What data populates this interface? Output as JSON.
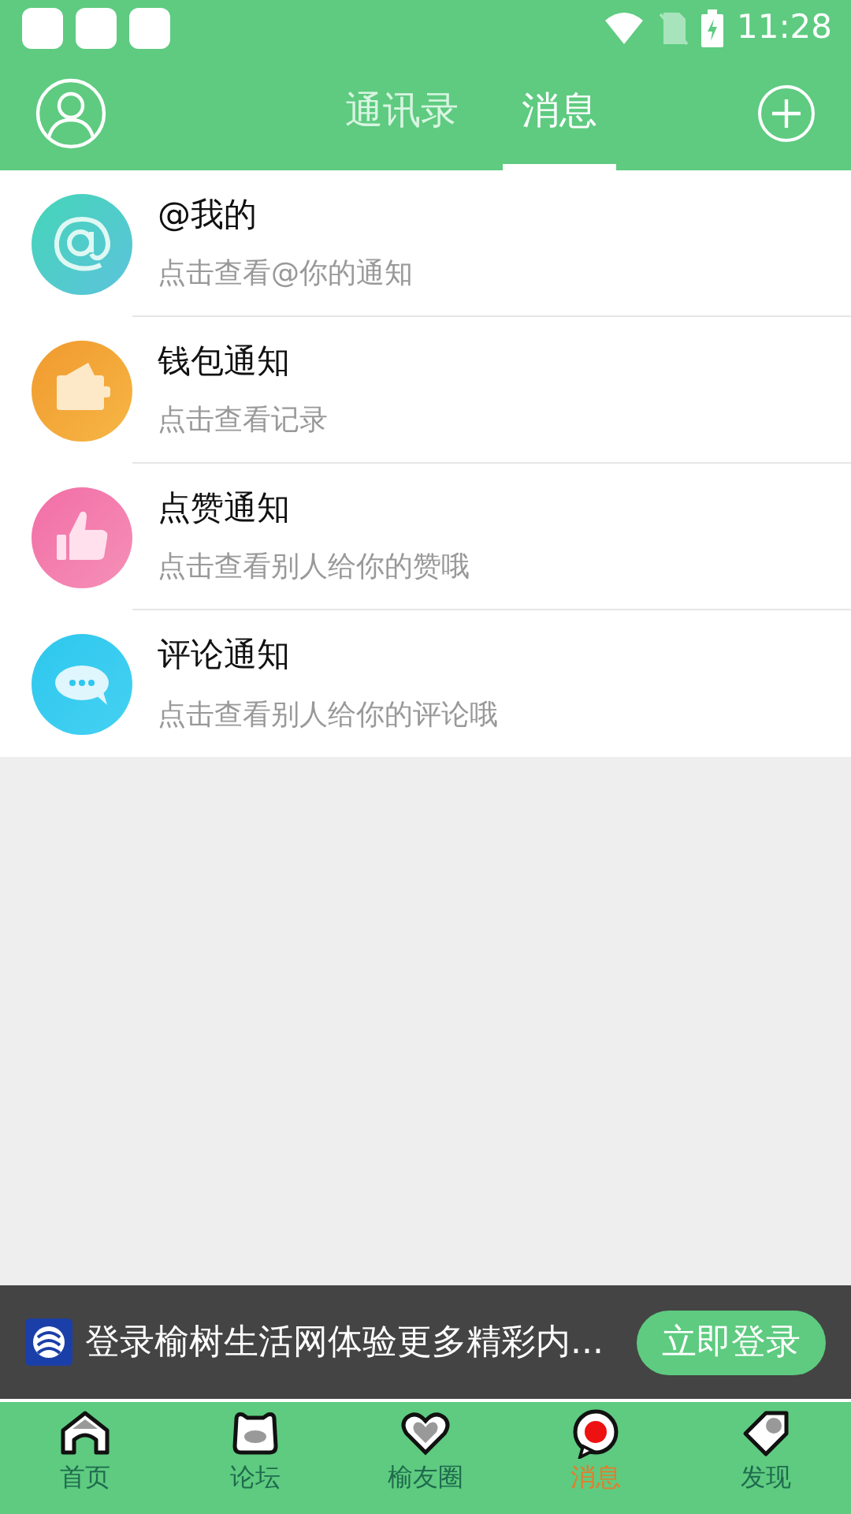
{
  "status_bar": {
    "time": "11:28"
  },
  "header": {
    "tabs": [
      {
        "label": "通讯录",
        "selected": false
      },
      {
        "label": "消息",
        "selected": true
      }
    ]
  },
  "messages": [
    {
      "kind": "mention",
      "title": "@我的",
      "subtitle": "点击查看@你的通知"
    },
    {
      "kind": "wallet",
      "title": "钱包通知",
      "subtitle": "点击查看记录"
    },
    {
      "kind": "like",
      "title": "点赞通知",
      "subtitle": "点击查看别人给你的赞哦"
    },
    {
      "kind": "comment",
      "title": "评论通知",
      "subtitle": "点击查看别人给你的评论哦"
    }
  ],
  "login_banner": {
    "text": "登录榆树生活网体验更多精彩内...",
    "button": "立即登录"
  },
  "bottom_nav": [
    {
      "kind": "home",
      "label": "首页",
      "selected": false
    },
    {
      "kind": "forum",
      "label": "论坛",
      "selected": false
    },
    {
      "kind": "friends",
      "label": "榆友圈",
      "selected": false
    },
    {
      "kind": "messages",
      "label": "消息",
      "selected": true
    },
    {
      "kind": "discover",
      "label": "发现",
      "selected": false
    }
  ]
}
